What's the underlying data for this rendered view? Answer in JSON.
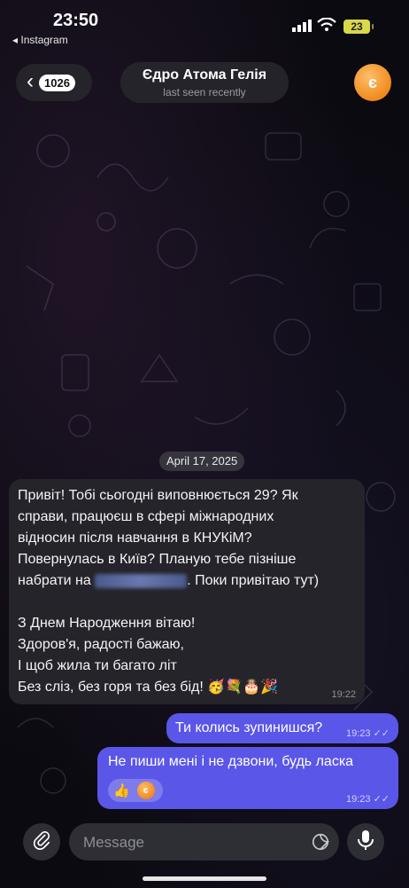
{
  "status": {
    "time": "23:50",
    "back_app": "◂ Instagram",
    "battery": "23"
  },
  "header": {
    "back_count": "1026",
    "name": "Єдро Атома Гелія",
    "last_seen": "last seen recently",
    "avatar_letter": "є"
  },
  "date_chip": "April 17, 2025",
  "incoming": {
    "lines": [
      "Привіт! Тобі сьогодні виповнюється 29? Як",
      "справи, працюєш в сфері міжнародних",
      "відносин після навчання в КНУКіМ?",
      "Повернулась в Київ? Планую тебе пізніше",
      "набрати на",
      ". Поки привітаю тут)",
      "З Днем Народження вітаю!",
      "Здоров'я, радості бажаю,",
      "І щоб жила ти багато літ",
      "Без сліз, без горя та без бід!"
    ],
    "emojis": "🥳💐🎂🎉",
    "time": "19:22"
  },
  "outgoing": [
    {
      "text": "Ти колись зупинишся?",
      "time": "19:23"
    },
    {
      "text": "Не пиши мені і не дзвони, будь ласка",
      "time": "19:23",
      "reaction_emoji": "👍",
      "reaction_avatar": "є"
    }
  ],
  "composer": {
    "placeholder": "Message"
  },
  "icons": [
    "chevron-left-icon",
    "paperclip-icon",
    "sticker-icon",
    "microphone-icon",
    "signal-icon",
    "wifi-icon",
    "double-check-icon"
  ]
}
